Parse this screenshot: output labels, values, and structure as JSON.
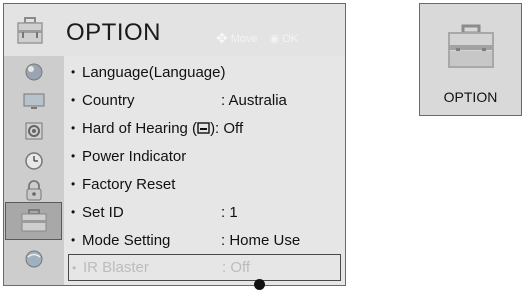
{
  "header": {
    "title": "OPTION",
    "move_hint": "Move",
    "ok_hint": "OK"
  },
  "sidebar": {
    "items": [
      {
        "name": "picture-icon"
      },
      {
        "name": "screen-icon"
      },
      {
        "name": "audio-icon"
      },
      {
        "name": "time-icon"
      },
      {
        "name": "lock-icon"
      },
      {
        "name": "option-icon",
        "active": true
      },
      {
        "name": "network-icon"
      }
    ]
  },
  "menu": {
    "items": [
      {
        "label": "Language(Language)",
        "value": ""
      },
      {
        "label": "Country",
        "value": ": Australia"
      },
      {
        "label": "Hard of Hearing (",
        "value": ""
      },
      {
        "label": "Power Indicator",
        "value": ""
      },
      {
        "label": "Factory Reset",
        "value": ""
      },
      {
        "label": "Set ID",
        "value": ": 1"
      },
      {
        "label": "Mode Setting",
        "value": ": Home Use"
      },
      {
        "label": "IR Blaster",
        "value": ": Off"
      }
    ],
    "hard_of_hearing_suffix": "): Off"
  },
  "preview": {
    "label": "OPTION"
  },
  "colors": {
    "frame": "#6a6a6a",
    "selection_border": "#4a4a4a",
    "disabled_text": "#bcbcbc"
  }
}
